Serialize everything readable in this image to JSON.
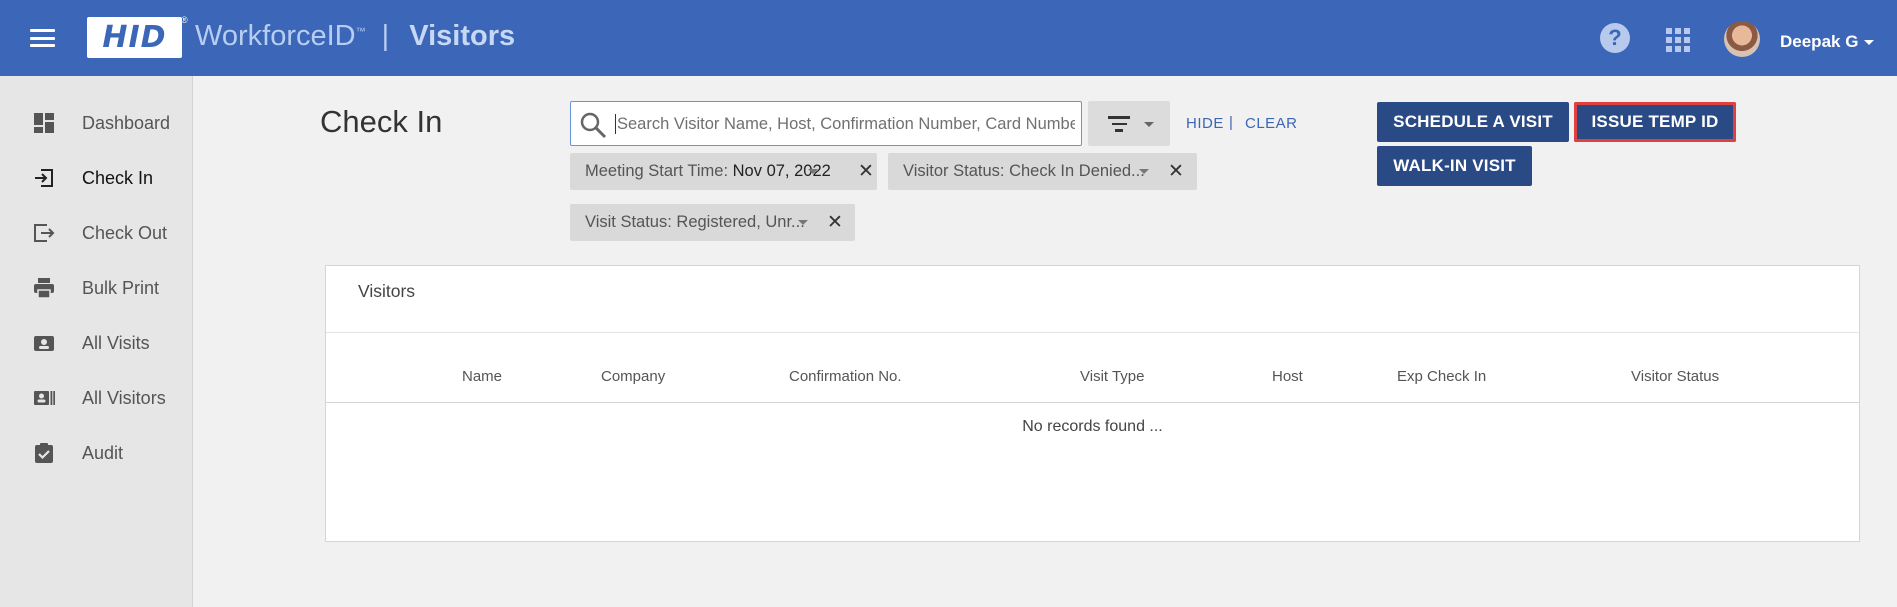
{
  "header": {
    "logo_text": "HID",
    "brand_name": "WorkforceID",
    "brand_tm": "™",
    "separator": "|",
    "app_name": "Visitors",
    "help_glyph": "?",
    "user_name": "Deepak G",
    "icons": [
      "menu-icon",
      "help-icon",
      "apps-grid-icon",
      "avatar",
      "chevron-down-icon"
    ],
    "brand_color": "#3c66b7"
  },
  "sidebar": {
    "items": [
      {
        "label": "Dashboard",
        "icon": "dashboard-icon"
      },
      {
        "label": "Check In",
        "icon": "check-in-icon",
        "active": true
      },
      {
        "label": "Check Out",
        "icon": "check-out-icon"
      },
      {
        "label": "Bulk Print",
        "icon": "printer-icon"
      },
      {
        "label": "All Visits",
        "icon": "visits-icon"
      },
      {
        "label": "All Visitors",
        "icon": "visitors-icon"
      },
      {
        "label": "Audit",
        "icon": "audit-icon"
      }
    ]
  },
  "main": {
    "page_title": "Check In",
    "search": {
      "placeholder": "Search Visitor Name, Host, Confirmation Number, Card Number",
      "value": ""
    },
    "hide_label": "HIDE",
    "clear_label": "CLEAR",
    "pipe": "|",
    "filters": [
      {
        "key": "Meeting Start Time: ",
        "value": "Nov 07, 2022"
      },
      {
        "key": "Visitor Status: Check In Denied...",
        "value": ""
      },
      {
        "key": "Visit Status: Registered, Unr...",
        "value": ""
      }
    ],
    "close_glyph": "✕",
    "buttons": {
      "schedule": "SCHEDULE A VISIT",
      "issue_temp_id": "ISSUE TEMP ID",
      "walk_in": "WALK-IN VISIT"
    },
    "button_color": "#2a4a86",
    "highlight_color": "#e0403f"
  },
  "table": {
    "title": "Visitors",
    "columns": [
      "Name",
      "Company",
      "Confirmation No.",
      "Visit Type",
      "Host",
      "Exp Check In",
      "Visitor Status"
    ],
    "empty_message": "No records found ..."
  }
}
